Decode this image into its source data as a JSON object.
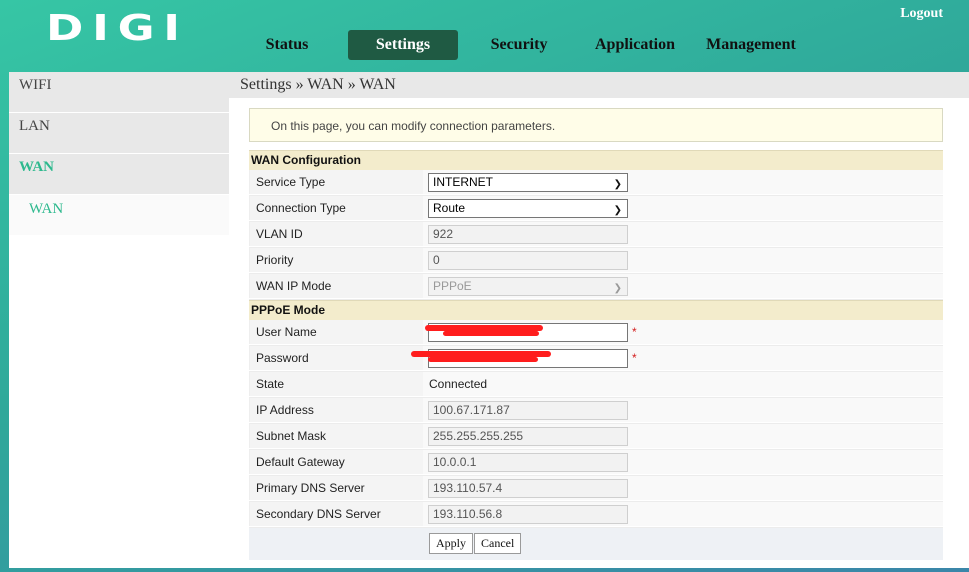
{
  "header": {
    "logo": "DIGI",
    "logout": "Logout",
    "nav": [
      {
        "label": "Status",
        "active": false
      },
      {
        "label": "Settings",
        "active": true
      },
      {
        "label": "Security",
        "active": false
      },
      {
        "label": "Application",
        "active": false
      },
      {
        "label": "Management",
        "active": false
      }
    ]
  },
  "sidebar": {
    "items": [
      {
        "label": "WIFI"
      },
      {
        "label": "LAN"
      },
      {
        "label": "WAN"
      }
    ],
    "sub": [
      {
        "label": "WAN"
      }
    ]
  },
  "breadcrumb": "Settings » WAN » WAN",
  "notice": "On this page, you can modify connection parameters.",
  "wan_config": {
    "title": "WAN Configuration",
    "service_type": {
      "label": "Service Type",
      "value": "INTERNET"
    },
    "connection_type": {
      "label": "Connection Type",
      "value": "Route"
    },
    "vlan_id": {
      "label": "VLAN ID",
      "value": "922"
    },
    "priority": {
      "label": "Priority",
      "value": "0"
    },
    "wan_ip_mode": {
      "label": "WAN IP Mode",
      "value": "PPPoE"
    }
  },
  "pppoe": {
    "title": "PPPoE Mode",
    "user_name": {
      "label": "User Name",
      "value": "",
      "required": "*"
    },
    "password": {
      "label": "Password",
      "value": "",
      "required": "*"
    },
    "state": {
      "label": "State",
      "value": "Connected"
    },
    "ip_address": {
      "label": "IP Address",
      "value": "100.67.171.87"
    },
    "subnet_mask": {
      "label": "Subnet Mask",
      "value": "255.255.255.255"
    },
    "default_gateway": {
      "label": "Default Gateway",
      "value": "10.0.0.1"
    },
    "primary_dns": {
      "label": "Primary DNS Server",
      "value": "193.110.57.4"
    },
    "secondary_dns": {
      "label": "Secondary DNS Server",
      "value": "193.110.56.8"
    }
  },
  "buttons": {
    "apply": "Apply",
    "cancel": "Cancel"
  },
  "icons": {
    "dropdown": "chevron-down-icon"
  },
  "colors": {
    "accent": "#2eb98e",
    "active_tab": "#1f5a43",
    "redaction": "#ff1d1d",
    "required": "#d32020"
  }
}
